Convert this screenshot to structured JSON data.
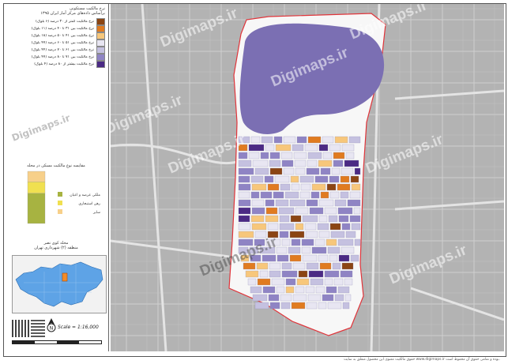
{
  "legend": {
    "title_line1": "نرخ مالکیت مستکونی",
    "title_line2": "براساس داده‌های مرکز آمار ایران ۱۳۹۵",
    "items": [
      {
        "label": "نرخ مالکیت کمتر از ۳۰ درصد (۶ بلوک)",
        "color": "#8b4513"
      },
      {
        "label": "نرخ مالکیت بین ۳۱ تا ۴۰ درصد (۱۱ بلوک)",
        "color": "#e07b20"
      },
      {
        "label": "نرخ مالکیت بین ۴۱ تا ۵۰ درصد (۱۸ بلوک)",
        "color": "#f7c77b"
      },
      {
        "label": "نرخ مالکیت بین ۵۱ تا ۶۰ درصد (۴۷ بلوک)",
        "color": "#e8e6f2"
      },
      {
        "label": "نرخ مالکیت بین ۶۱ تا ۷۰ درصد (۴۴ بلوک)",
        "color": "#c5c1e0"
      },
      {
        "label": "نرخ مالکیت بین ۷۱ تا ۸۰ درصد (۴۷ بلوک)",
        "color": "#8f84c4"
      },
      {
        "label": "نرخ مالکیت بیشتر از ۸۰ درصد (۴ بلوک)",
        "color": "#4b2a84"
      }
    ],
    "watermark": "Digimaps.ir"
  },
  "chart_data": {
    "type": "bar",
    "title": "مقایسه نوع مالکیت مسکن در محله",
    "categories": [
      ""
    ],
    "series": [
      {
        "name": "ملکی عرصه و اعیان",
        "values": [
          58
        ],
        "color": "#a7b341"
      },
      {
        "name": "رهن استیجاری",
        "values": [
          22
        ],
        "color": "#f0e050"
      },
      {
        "name": "سایر",
        "values": [
          20
        ],
        "color": "#f7d08a"
      }
    ],
    "ylim": [
      0,
      100
    ]
  },
  "locator": {
    "title_line1": "محله کوی نصر",
    "title_line2": "منطقه (۲) شهرداری تهران"
  },
  "scale_text": "Scale = 1:16,000",
  "north_label": "N",
  "footer_text": "حقوق مالکیت معنوی این محصول متعلق به سایت www.digimaps.ir بوده و تمامی حقوق آن محفوظ است.",
  "map": {
    "watermarks": [
      "Digimaps.ir",
      "Digimaps.ir",
      "Digimaps.ir",
      "Digimaps.ir",
      "Digimaps.ir",
      "Digimaps.ir",
      "Digimaps.ir",
      "Digimaps.ir"
    ],
    "colors": {
      "lake": "#7b6fb3",
      "boundary": "#e0343a",
      "basemap": "#b8b8b8",
      "district_fill": "#f7f7f7"
    }
  }
}
